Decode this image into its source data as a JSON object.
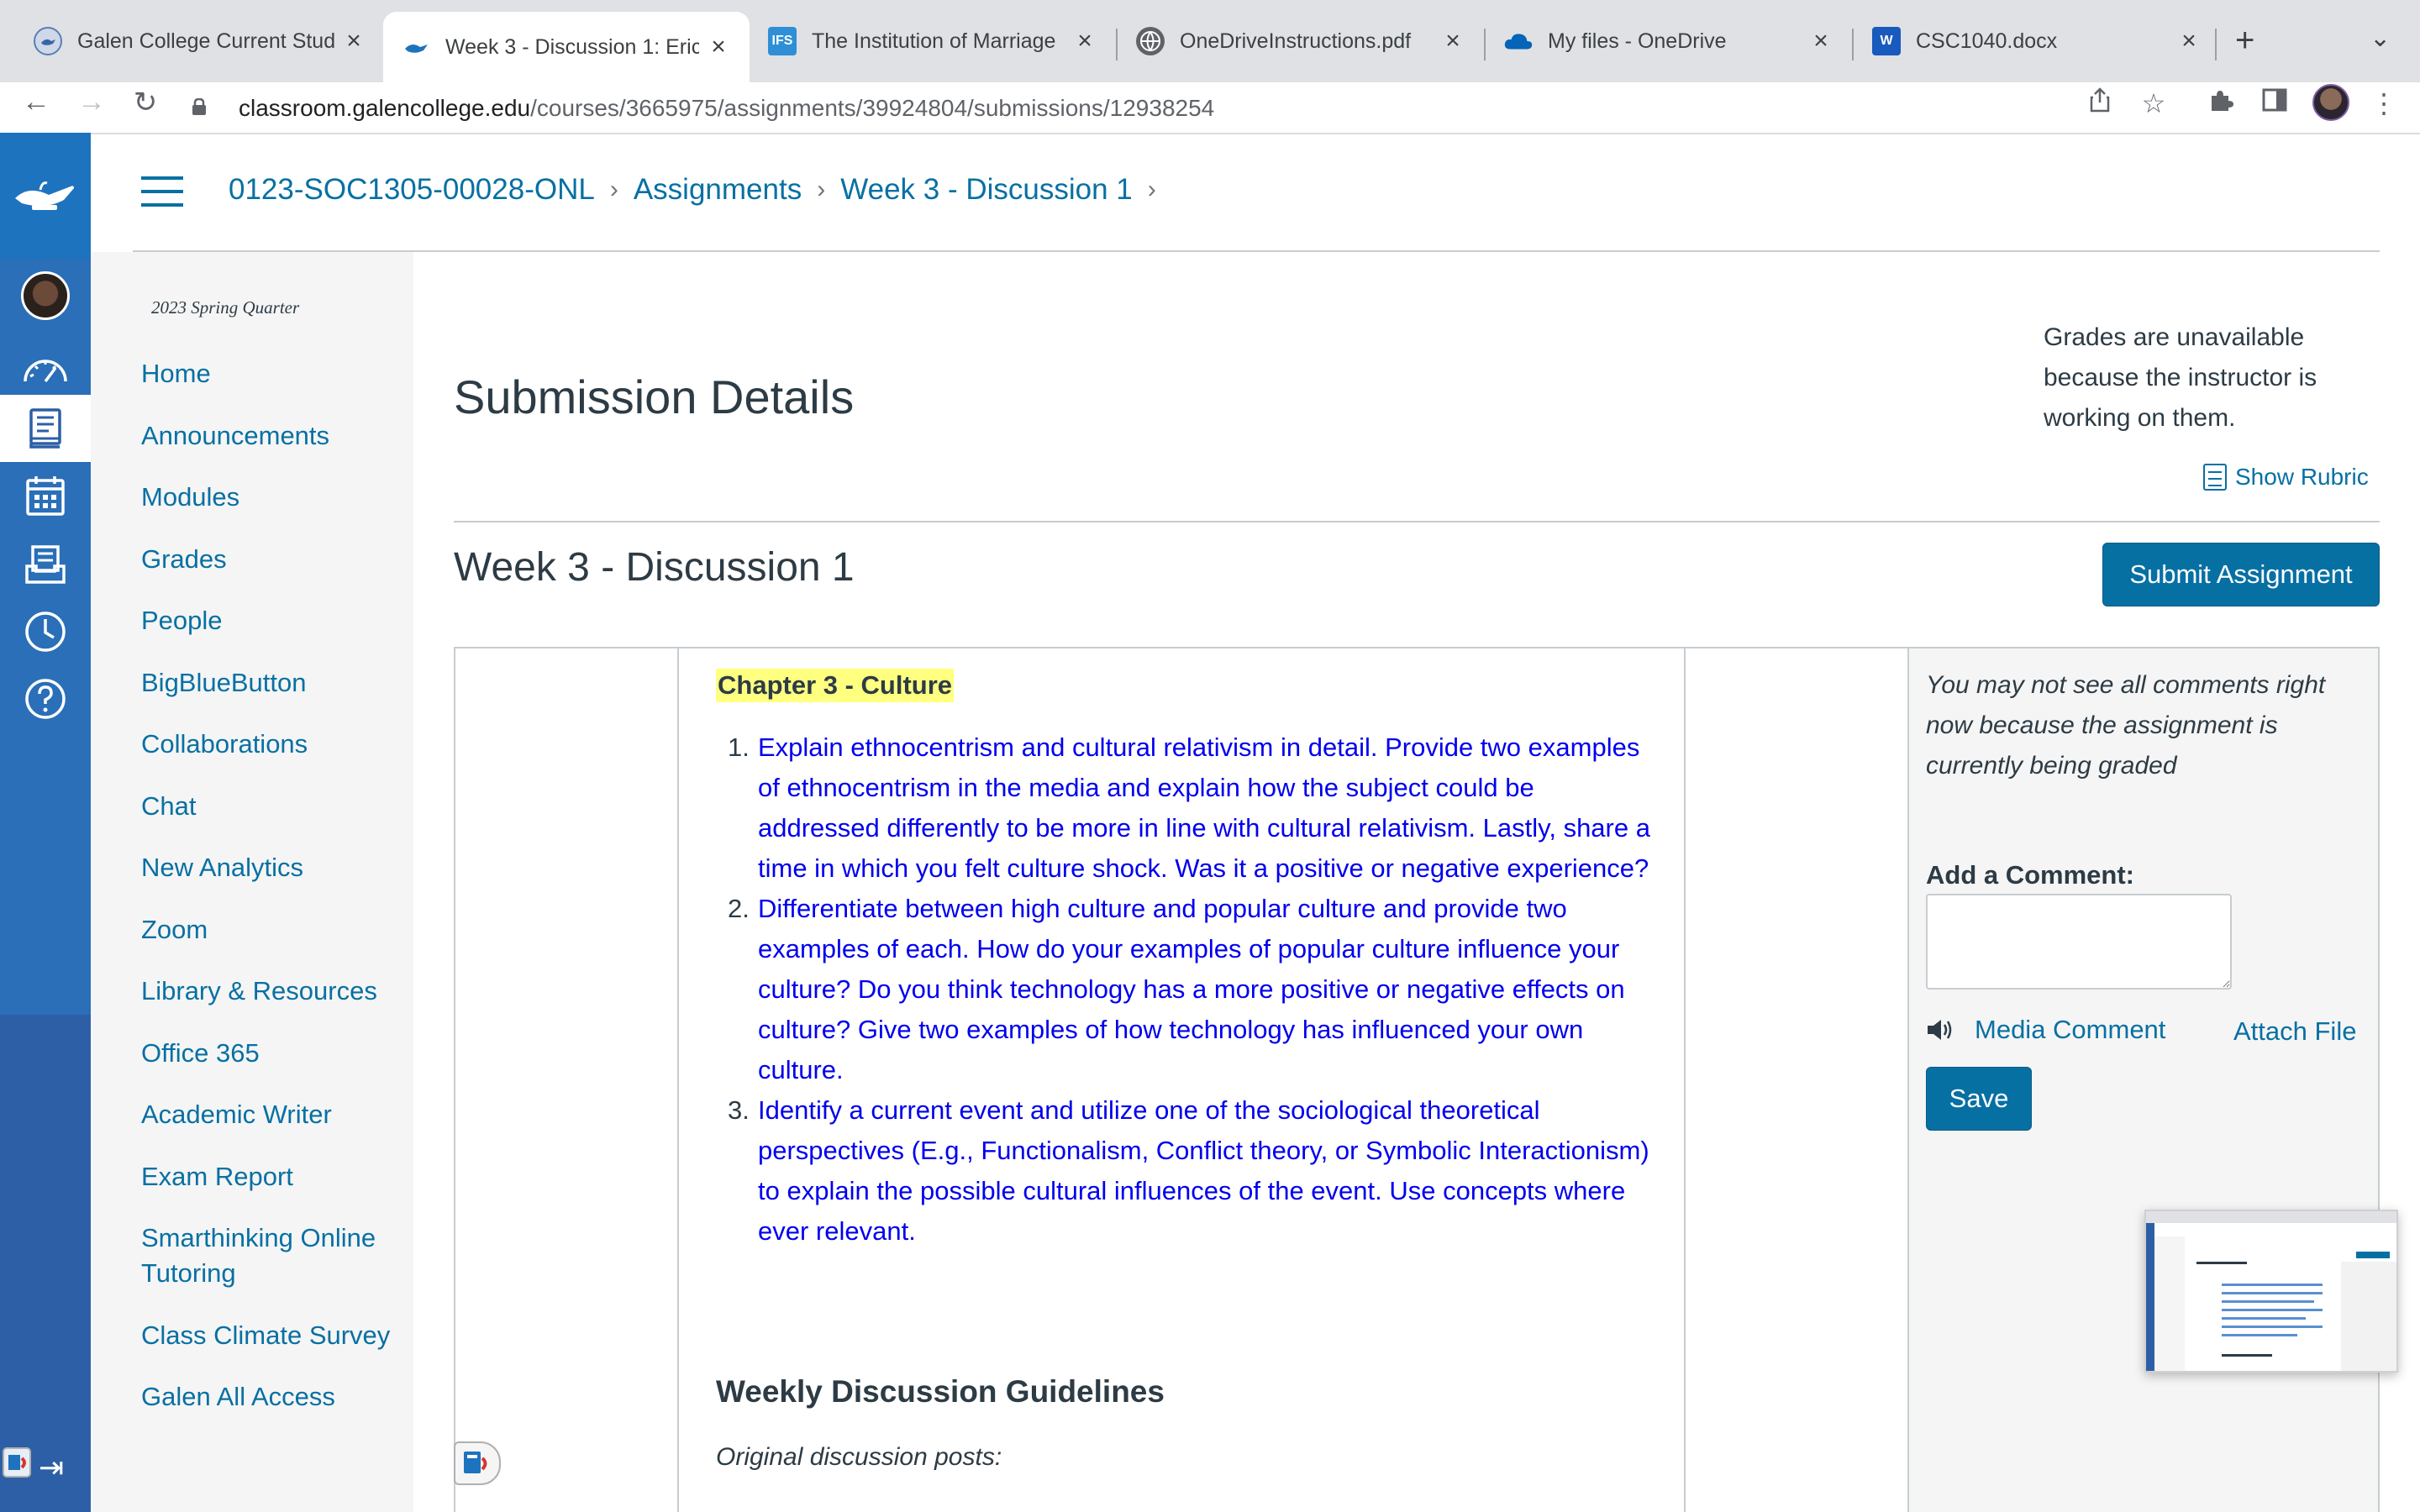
{
  "browser": {
    "tabs": [
      {
        "title": "Galen College Current Stud",
        "icon": "galen-lamp-icon",
        "active": false
      },
      {
        "title": "Week 3 - Discussion 1: Eric",
        "icon": "canvas-lamp-icon",
        "active": true
      },
      {
        "title": "The Institution of Marriage",
        "icon": "ifs-icon",
        "icon_text": "IFS",
        "active": false
      },
      {
        "title": "OneDriveInstructions.pdf",
        "icon": "globe-icon",
        "active": false
      },
      {
        "title": "My files - OneDrive",
        "icon": "onedrive-cloud-icon",
        "active": false
      },
      {
        "title": "CSC1040.docx",
        "icon": "word-icon",
        "icon_text": "W",
        "active": false
      }
    ],
    "url_host": "classroom.galencollege.edu",
    "url_path": "/courses/3665975/assignments/39924804/submissions/12938254"
  },
  "breadcrumb": [
    {
      "label": "0123-SOC1305-00028-ONL"
    },
    {
      "label": "Assignments"
    },
    {
      "label": "Week 3 - Discussion 1"
    }
  ],
  "course_nav": {
    "term": "2023 Spring Quarter",
    "items": [
      {
        "label": "Home"
      },
      {
        "label": "Announcements"
      },
      {
        "label": "Modules"
      },
      {
        "label": "Grades"
      },
      {
        "label": "People"
      },
      {
        "label": "BigBlueButton"
      },
      {
        "label": "Collaborations"
      },
      {
        "label": "Chat"
      },
      {
        "label": "New Analytics"
      },
      {
        "label": "Zoom"
      },
      {
        "label": "Library & Resources"
      },
      {
        "label": "Office 365"
      },
      {
        "label": "Academic Writer"
      },
      {
        "label": "Exam Report"
      },
      {
        "label": "Smarthinking Online",
        "label2": "Tutoring"
      },
      {
        "label": "Class Climate Survey"
      },
      {
        "label": "Galen All Access"
      }
    ]
  },
  "main": {
    "page_title": "Submission Details",
    "grades_note": "Grades are unavailable because the instructor is working on them.",
    "show_rubric": "Show Rubric",
    "assignment_title": "Week 3 - Discussion 1",
    "submit_button": "Submit Assignment",
    "chapter_heading": "Chapter 3 - Culture",
    "prompts": [
      {
        "num": "1.",
        "text": "Explain ethnocentrism and cultural relativism in detail. Provide two examples of ethnocentrism in the media and explain how the subject could be addressed differently to be more in line with cultural relativism. Lastly, share a time in which you felt culture shock. Was it a positive or negative experience?"
      },
      {
        "num": "2.",
        "text": "Differentiate between high culture and popular culture and provide two examples of each. How do your examples of popular culture influence your culture? Do you think technology has a more positive or negative effects on culture? Give two examples of how technology has influenced your own culture."
      },
      {
        "num": "3.",
        "text": "Identify a current event and utilize one of the sociological theoretical perspectives (E.g., Functionalism, Conflict theory, or Symbolic Interactionism) to explain the possible cultural influences of the event. Use concepts where ever relevant."
      }
    ],
    "guidelines_heading": "Weekly Discussion Guidelines",
    "original_posts_label": "Original discussion posts:"
  },
  "comments": {
    "note": "You may not see all comments right now because the assignment is currently being graded",
    "add_comment_label": "Add a Comment:",
    "media_comment": "Media Comment",
    "attach_file": "Attach File",
    "save_button": "Save"
  },
  "colors": {
    "canvas_blue": "#0770a3",
    "global_nav": "#2d5fa6",
    "link_blue_text": "#0000ee",
    "highlight": "#ffff80"
  }
}
